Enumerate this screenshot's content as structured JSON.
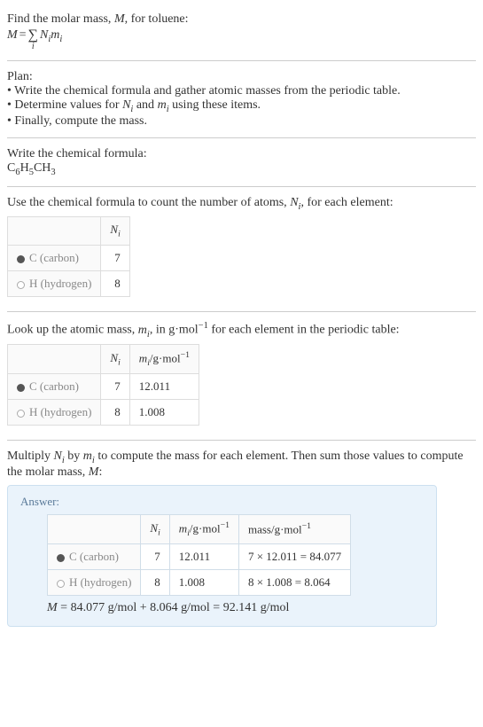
{
  "intro": {
    "line1_pre": "Find the molar mass, ",
    "line1_var": "M",
    "line1_post": ", for toluene:",
    "eq_lhs": "M",
    "eq_eq": " = ",
    "eq_rhs_Ni": "N",
    "eq_rhs_i1": "i",
    "eq_rhs_mi": "m",
    "eq_rhs_i2": "i",
    "sigma_sub": "i"
  },
  "plan": {
    "heading": "Plan:",
    "b1": "• Write the chemical formula and gather atomic masses from the periodic table.",
    "b2_pre": "• Determine values for ",
    "b2_Ni": "N",
    "b2_i1": "i",
    "b2_and": " and ",
    "b2_mi": "m",
    "b2_i2": "i",
    "b2_post": " using these items.",
    "b3": "• Finally, compute the mass."
  },
  "chem": {
    "heading": "Write the chemical formula:",
    "c1": "C",
    "s1": "6",
    "c2": "H",
    "s2": "5",
    "c3": "CH",
    "s3": "3"
  },
  "count": {
    "line_pre": "Use the chemical formula to count the number of atoms, ",
    "Nvar": "N",
    "Ni": "i",
    "line_post": ", for each element:",
    "hdr_N": "N",
    "hdr_Ni": "i",
    "row1_el": "C (carbon)",
    "row1_n": "7",
    "row2_el": "H (hydrogen)",
    "row2_n": "8"
  },
  "mass": {
    "line_pre": "Look up the atomic mass, ",
    "mvar": "m",
    "mi": "i",
    "line_mid": ", in g·mol",
    "exp": "−1",
    "line_post": " for each element in the periodic table:",
    "hdr_N": "N",
    "hdr_Ni": "i",
    "hdr_m": "m",
    "hdr_mi": "i",
    "hdr_unit_pre": "/g·mol",
    "hdr_unit_exp": "−1",
    "row1_el": "C (carbon)",
    "row1_n": "7",
    "row1_m": "12.011",
    "row2_el": "H (hydrogen)",
    "row2_n": "8",
    "row2_m": "1.008"
  },
  "mult": {
    "pre": "Multiply ",
    "N": "N",
    "Ni": "i",
    "by": " by ",
    "m": "m",
    "mi": "i",
    "mid": " to compute the mass for each element. Then sum those values to compute the molar mass, ",
    "Mvar": "M",
    "post": ":"
  },
  "answer": {
    "label": "Answer:",
    "hdr_N": "N",
    "hdr_Ni": "i",
    "hdr_m": "m",
    "hdr_mi": "i",
    "hdr_m_unit_pre": "/g·mol",
    "hdr_m_unit_exp": "−1",
    "hdr_mass_pre": "mass/g·mol",
    "hdr_mass_exp": "−1",
    "row1_el": "C (carbon)",
    "row1_n": "7",
    "row1_m": "12.011",
    "row1_mass": "7 × 12.011 = 84.077",
    "row2_el": "H (hydrogen)",
    "row2_n": "8",
    "row2_m": "1.008",
    "row2_mass": "8 × 1.008 = 8.064",
    "final_M": "M",
    "final_rest": " = 84.077 g/mol + 8.064 g/mol = 92.141 g/mol"
  }
}
